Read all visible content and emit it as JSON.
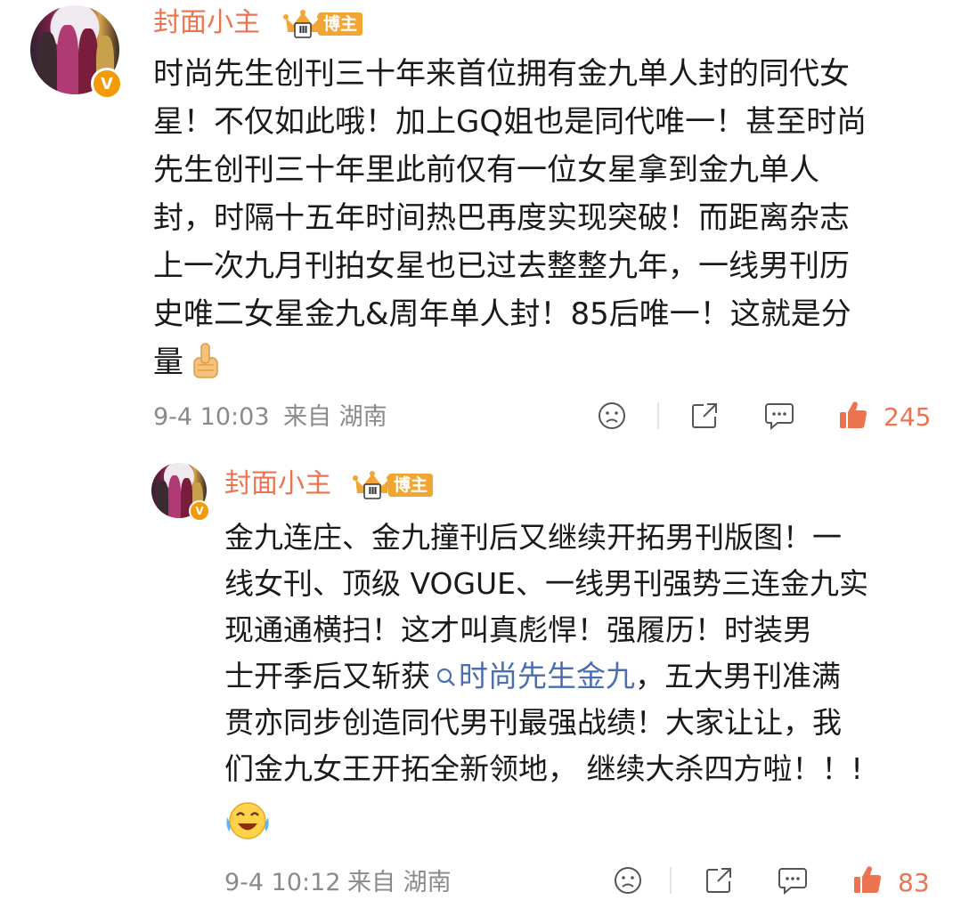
{
  "comment": {
    "author": "封面小主",
    "role_badge": "博主",
    "level_badge": "III",
    "verified_mark": "V",
    "lines": [
      "时尚先生创刊三十年来首位拥有金九单人封的同代女",
      "星！不仅如此哦！加上GQ姐也是同代唯一！甚至时尚",
      "先生创刊三十年里此前仅有一位女星拿到金九单人",
      "封，时隔十五年时间热巴再度实现突破！而距离杂志",
      "上一次九月刊拍女星也已过去整整九年，一线男刊历",
      "史唯二女星金九&周年单人封！85后唯一！这就是分",
      "量"
    ],
    "end_emoji": "thumbs-up-emoji",
    "time": "9-4 10:03",
    "location": "来自 湖南",
    "likes": "245"
  },
  "reply": {
    "author": "封面小主",
    "role_badge": "博主",
    "level_badge": "III",
    "verified_mark": "V",
    "lines": [
      "金九连庄、金九撞刊后又继续开拓男刊版图！一",
      "线女刊、顶级 VOGUE、一线男刊强势三连金九实",
      "现通通横扫！这才叫真彪悍！强履历！时装男",
      "士开季后又斩获"
    ],
    "topic_link": "时尚先生金九",
    "line4_tail": "，五大男刊准满",
    "lines_after": [
      "贯亦同步创造同代男刊最强战绩！大家让让，我",
      "们金九女王开拓全新领地， 继续大杀四方啦！！!"
    ],
    "end_emoji": "tears-of-joy-emoji",
    "time": "9-4 10:12",
    "location": "来自 湖南",
    "likes": "83"
  },
  "icons": [
    "dislike-face-icon",
    "share-icon",
    "comment-icon",
    "like-thumb-icon",
    "search-icon"
  ],
  "colors": {
    "username": "#eb7350",
    "badge": "#f1a532",
    "topic": "#4a6fb0",
    "meta": "#8a8a8a",
    "verified": "#f39a0a"
  }
}
